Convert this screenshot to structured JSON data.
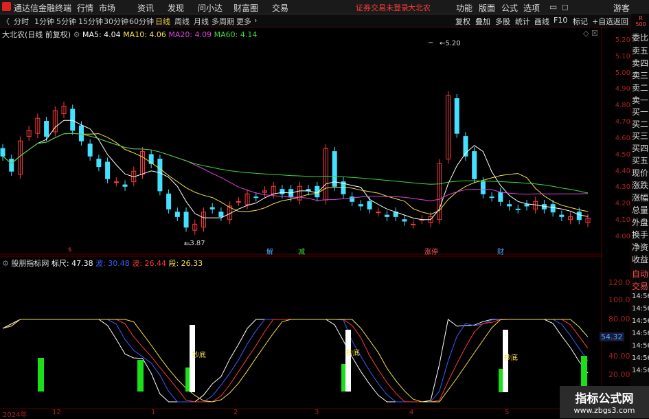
{
  "app": {
    "title": "通达信金融终端",
    "status_text": "证券交易未登录",
    "stock_short": "大北农",
    "guest": "游客"
  },
  "menu": [
    "行情",
    "市场",
    "资讯",
    "发现",
    "问小达",
    "财富圈",
    "交易"
  ],
  "menu_right": [
    "功能",
    "版面",
    "公式",
    "选项"
  ],
  "periods": [
    "分时",
    "1分钟",
    "5分钟",
    "15分钟",
    "30分钟",
    "60分钟",
    "日线",
    "周线",
    "月线",
    "多周期",
    "更多"
  ],
  "active_period": "日线",
  "right_tools": [
    "复权",
    "叠加",
    "多股",
    "统计",
    "画线",
    "F10",
    "标记",
    "+自选",
    "返回"
  ],
  "chart_title": "大北农(日线 前复权)",
  "ma": [
    {
      "label": "MA5: 4.04",
      "color": "#ffffff"
    },
    {
      "label": "MA10: 4.06",
      "color": "#f7e04a"
    },
    {
      "label": "MA20: 4.09",
      "color": "#e040e0"
    },
    {
      "label": "MA60: 4.14",
      "color": "#3adb3a"
    }
  ],
  "upper_axis": [
    "5.20",
    "5.10",
    "5.00",
    "4.90",
    "4.80",
    "4.70",
    "4.60",
    "4.50",
    "4.40",
    "4.30",
    "4.20",
    "4.10",
    "4.00"
  ],
  "annotations": {
    "high": "5.20",
    "low": "3.87"
  },
  "event_tags": [
    {
      "text": "解",
      "color": "#4aa8ff"
    },
    {
      "text": "减",
      "color": "#3adb3a"
    },
    {
      "text": "涨停",
      "color": "#ff5a5a"
    },
    {
      "text": "财",
      "color": "#4aa8ff"
    }
  ],
  "lower_indicator": {
    "name": "股朋指标网",
    "items": [
      {
        "label": "标尺: 47.38",
        "color": "#ffffff"
      },
      {
        "label": "波: 30.48",
        "color": "#3a5bff"
      },
      {
        "label": "波: 26.44",
        "color": "#ff3a3a"
      },
      {
        "label": "段: 26.33",
        "color": "#f7e04a"
      }
    ],
    "marker": "抄底",
    "current_value": "54.32"
  },
  "lower_axis": [
    "120.00",
    "100.00",
    "80.00",
    "40.00",
    "20.00"
  ],
  "x_axis": [
    "2024年",
    "12",
    "1",
    "2",
    "3",
    "4",
    "5"
  ],
  "sidebar": [
    "R\n500",
    "委比",
    "卖五",
    "卖四",
    "卖三",
    "卖二",
    "卖一",
    "买一",
    "买二",
    "买三",
    "买四",
    "买五",
    "现价",
    "涨跌",
    "涨幅",
    "总量",
    "外盘",
    "换手",
    "净资",
    "收益",
    "自动",
    "交易",
    "14:56",
    "14:56",
    "14:56",
    "14:56",
    "14:56",
    "14:56",
    "14:56"
  ],
  "watermark": {
    "line1": "指标公式网",
    "line2": "www.zbgs3.com"
  },
  "chart_data": {
    "type": "candlestick",
    "title": "大北农(日线 前复权)",
    "y_range": [
      3.87,
      5.2
    ],
    "series_close": [
      4.45,
      4.35,
      4.55,
      4.62,
      4.7,
      4.58,
      4.75,
      4.78,
      4.62,
      4.55,
      4.45,
      4.38,
      4.3,
      4.28,
      4.25,
      4.35,
      4.48,
      4.4,
      4.22,
      4.1,
      4.05,
      3.98,
      4.0,
      4.08,
      4.1,
      4.05,
      4.12,
      4.15,
      4.2,
      4.18,
      4.22,
      4.25,
      4.2,
      4.18,
      4.25,
      4.22,
      4.18,
      4.5,
      4.25,
      4.2,
      4.15,
      4.12,
      4.1,
      4.08,
      4.05,
      4.05,
      4.02,
      4.0,
      4.03,
      4.05,
      4.4,
      4.85,
      4.6,
      4.45,
      4.3,
      4.2,
      4.18,
      4.15,
      4.12,
      4.1,
      4.12,
      4.15,
      4.1,
      4.08,
      4.05,
      4.05,
      4.03,
      4.04
    ]
  }
}
